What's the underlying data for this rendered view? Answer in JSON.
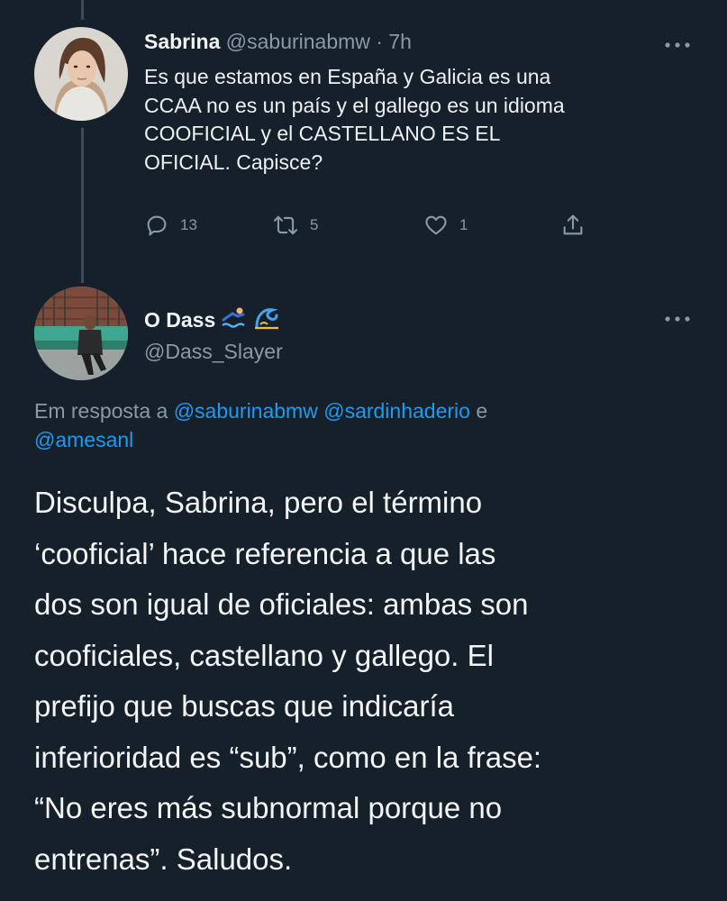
{
  "tweet_parent": {
    "name": "Sabrina",
    "handle": "@saburinabmw",
    "separator": "·",
    "time": "7h",
    "text_lines": [
      "Es que estamos en España y Galicia es una",
      "CCAA no es un país y el gallego es un idioma",
      "COOFICIAL y el CASTELLANO ES EL",
      "OFICIAL. Capisce?"
    ],
    "stats": {
      "replies": "13",
      "retweets": "5",
      "likes": "1"
    },
    "icons": [
      "more-icon",
      "reply-icon",
      "retweet-icon",
      "like-icon",
      "share-icon"
    ]
  },
  "tweet_reply": {
    "name": "O Dass",
    "name_emojis": [
      "swimmer-emoji",
      "wave-emoji"
    ],
    "handle": "@Dass_Slayer",
    "replying_prefix": "Em resposta a",
    "mention_1": "@saburinabmw",
    "mention_2": "@sardinhaderio",
    "conjunction": "e",
    "mention_3": "@amesanl",
    "text_lines": [
      "Disculpa, Sabrina, pero el término",
      "‘cooficial’ hace referencia a que las",
      "dos son igual de oficiales: ambas son",
      "cooficiales, castellano y gallego. El",
      "prefijo que buscas que indicaría",
      "inferioridad es “sub”, como en la frase:",
      "“No eres más subnormal porque no",
      "entrenas”. Saludos."
    ]
  },
  "colors": {
    "background": "#15202b",
    "text": "#e8ecef",
    "secondary": "#8b98a5",
    "link": "#1d9bf0"
  }
}
